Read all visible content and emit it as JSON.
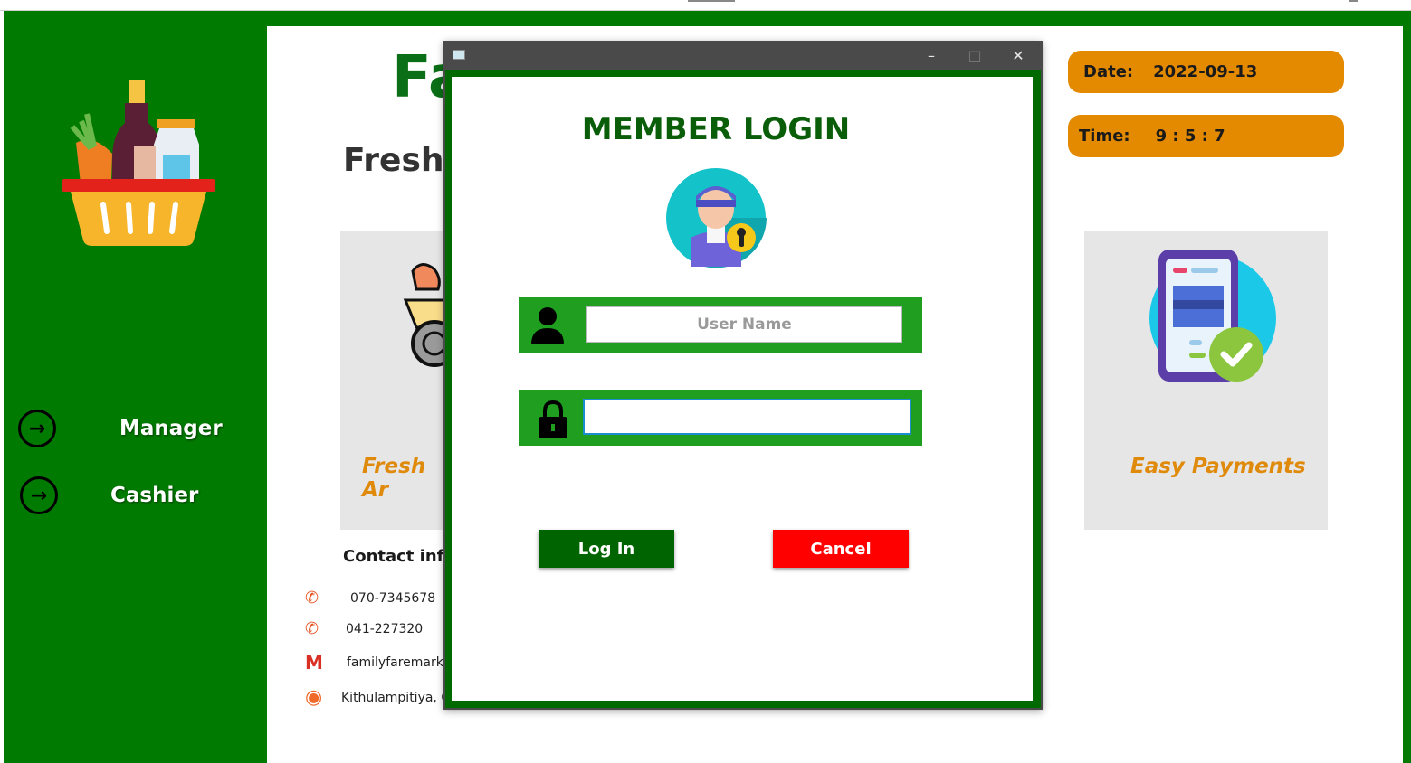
{
  "app": {
    "headline_fragment": "Fa",
    "subhead_fragment": "Fresh",
    "sidebar": {
      "items": [
        {
          "label": "Manager",
          "icon": "arrow-right-circle-icon"
        },
        {
          "label": "Cashier",
          "icon": "arrow-right-circle-icon"
        }
      ]
    },
    "cards": {
      "left_caption": "Fresh Ar",
      "right_caption": "Easy Payments"
    },
    "date": {
      "label": "Date:",
      "value": "2022-09-13"
    },
    "time": {
      "label": "Time:",
      "value": "9 : 5 : 7"
    },
    "contact": {
      "title": "Contact info",
      "phone1": "070-7345678",
      "phone2": "041-227320",
      "email": "familyfaremarke",
      "address": "Kithulampitiya, G"
    }
  },
  "dialog": {
    "title": "MEMBER LOGIN",
    "username_placeholder": "User Name",
    "password_value": "",
    "login_label": "Log In",
    "cancel_label": "Cancel",
    "titlebar": {
      "minimize": "–",
      "maximize": "□",
      "close": "✕"
    }
  },
  "colors": {
    "brand_green": "#007a00",
    "dialog_green": "#006a00",
    "field_green": "#1f9e1f",
    "orange": "#e38a00",
    "cancel_red": "#ff0000"
  }
}
